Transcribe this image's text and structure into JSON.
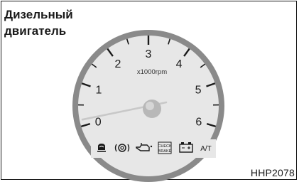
{
  "heading": {
    "line1": "Дизельный",
    "line2": "двигатель"
  },
  "gauge": {
    "unit_label": "x1000rpm",
    "scale_labels": [
      "0",
      "1",
      "2",
      "3",
      "4",
      "5",
      "6"
    ],
    "needle_value": 0.15,
    "indicators": [
      {
        "name": "glow-plug-icon",
        "text": ""
      },
      {
        "name": "brake-warning-icon",
        "text": "(◎)"
      },
      {
        "name": "oil-pressure-icon",
        "text": ""
      },
      {
        "name": "check-brake-icon",
        "text": "CHECK BRAKE"
      },
      {
        "name": "battery-icon",
        "text": ""
      },
      {
        "name": "at-indicator-icon",
        "text": "A/T"
      }
    ]
  },
  "figure_code": "HHP2078",
  "colors": {
    "dial_face": "#e7e7e7",
    "dial_rim": "#8a8a8a",
    "ink": "#1a1a1a"
  }
}
